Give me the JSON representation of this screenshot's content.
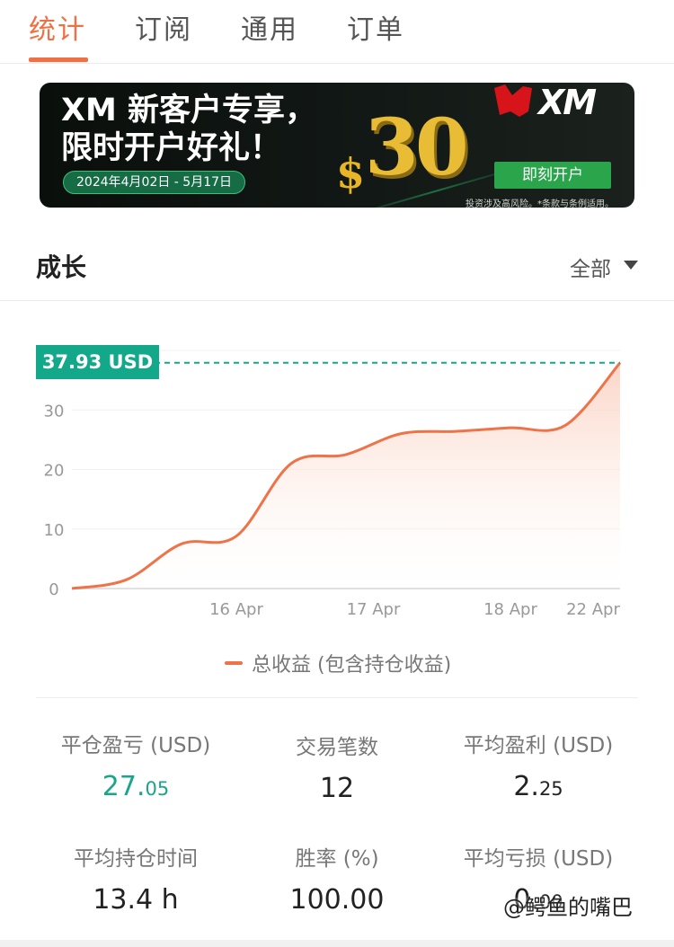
{
  "tabs": [
    {
      "label": "统计",
      "active": true
    },
    {
      "label": "订阅",
      "active": false
    },
    {
      "label": "通用",
      "active": false
    },
    {
      "label": "订单",
      "active": false
    }
  ],
  "banner": {
    "line1": "XM 新客户专享，",
    "line2": "限时开户好礼！",
    "dates": "2024年4月02日 - 5月17日",
    "amount_symbol": "$",
    "amount": "30",
    "brand": "XM",
    "cta": "即刻开户",
    "disclaimer": "投资涉及高风险。*条款与条例适用。"
  },
  "section": {
    "title": "成长",
    "filter": "全部"
  },
  "chart_data": {
    "type": "area",
    "current_value_label": "37.93 USD",
    "current_value": 37.93,
    "y_ticks": [
      0,
      10,
      20,
      30
    ],
    "ylim": [
      0,
      40
    ],
    "x_ticks": [
      "16 Apr",
      "17 Apr",
      "18 Apr",
      "22 Apr"
    ],
    "series": [
      {
        "name": "总收益 (包含持仓收益)",
        "points": [
          [
            0.0,
            0.0
          ],
          [
            0.5,
            1.5
          ],
          [
            1.0,
            7.5
          ],
          [
            1.5,
            8.8
          ],
          [
            2.0,
            21.0
          ],
          [
            2.5,
            22.5
          ],
          [
            3.0,
            26.0
          ],
          [
            3.5,
            26.4
          ],
          [
            4.0,
            27.0
          ],
          [
            4.5,
            27.4
          ],
          [
            5.0,
            37.93
          ]
        ]
      }
    ],
    "x_tick_positions": [
      1.5,
      2.75,
      4.0,
      5.0
    ],
    "xlim": [
      0,
      5
    ],
    "line_color": "#ef7349",
    "fill_color": "#fde3da",
    "reference_line_color": "#13a88a",
    "grid": true
  },
  "legend": {
    "label": "总收益 (包含持仓收益)"
  },
  "stats": [
    {
      "label": "平仓盈亏 (USD)",
      "main": "27.",
      "fraction": "05",
      "color": "green"
    },
    {
      "label": "交易笔数",
      "main": "12",
      "fraction": ""
    },
    {
      "label": "平均盈利 (USD)",
      "main": "2.",
      "fraction": "25"
    },
    {
      "label": "平均持仓时间",
      "main": "13.4 h",
      "fraction": ""
    },
    {
      "label": "胜率 (%)",
      "main": "100.00",
      "fraction": ""
    },
    {
      "label": "平均亏损 (USD)",
      "main": "0.",
      "fraction": "00"
    }
  ],
  "watermark": "@鳄鱼的嘴巴"
}
